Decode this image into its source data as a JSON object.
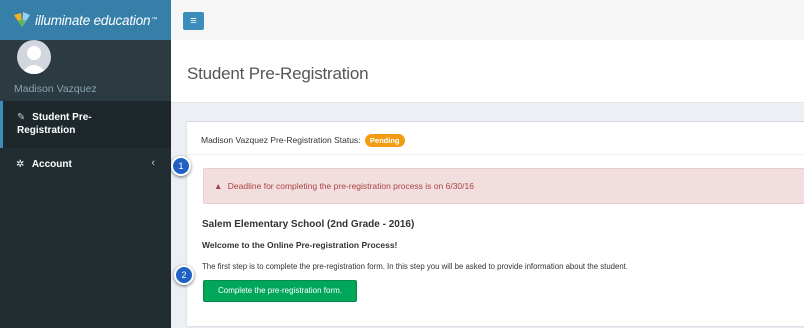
{
  "app": {
    "logo_text": "illuminate education",
    "logo_tm": "™",
    "menu_toggle_glyph": "≡"
  },
  "user": {
    "name": "Madison Vazquez"
  },
  "sidebar": {
    "items": [
      {
        "label_line1": "Student Pre-",
        "label_line2": "Registration",
        "icon": "tag-icon",
        "glyph": "✎"
      },
      {
        "label": "Account",
        "icon": "gear-icon",
        "glyph": "✲",
        "chevron": "‹"
      }
    ]
  },
  "header": {
    "title": "Student Pre-Registration"
  },
  "box": {
    "status_label": "Madison Vazquez Pre-Registration Status:",
    "status_badge": "Pending",
    "alert_icon": "▲",
    "alert_text": "Deadline for completing the pre-registration process is on 6/30/16",
    "school": "Salem Elementary School (2nd Grade - 2016)",
    "welcome": "Welcome to the Online Pre-registration Process!",
    "step_text": "The first step is to complete the pre-registration form. In this step you will be asked to provide information about the student.",
    "button_label": "Complete the pre-registration form."
  },
  "markers": [
    "1",
    "2"
  ],
  "colors": {
    "sidebar_bg": "#222d32",
    "logo_bg": "#367fa9",
    "accent": "#3c8dbc",
    "badge": "#f39c12",
    "alert_bg": "#f2dede",
    "alert_text": "#a94442",
    "button": "#00a65a",
    "marker": "#2161c4"
  }
}
